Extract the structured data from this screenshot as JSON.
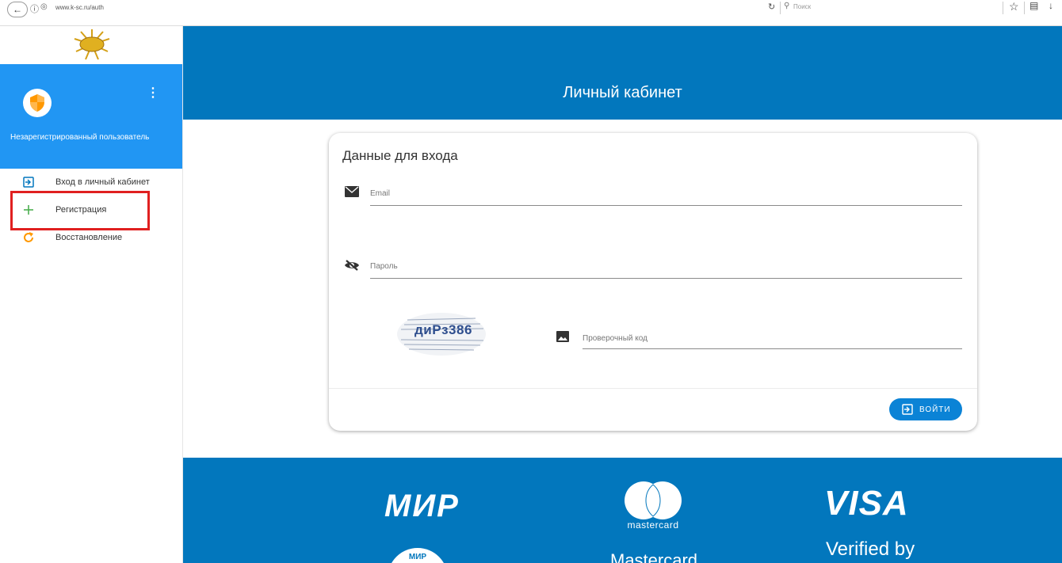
{
  "browser": {
    "url": "www.k-sc.ru/auth",
    "search_placeholder": "Поиск"
  },
  "sidebar": {
    "user_name": "Незарегистрированный пользователь",
    "menu_items": [
      {
        "label": "Вход в личный кабинет",
        "icon": "login-icon",
        "color": "#0277bd"
      },
      {
        "label": "Регистрация",
        "icon": "plus-icon",
        "color": "#4caf50"
      },
      {
        "label": "Восстановление",
        "icon": "refresh-icon",
        "color": "#ff9800"
      }
    ]
  },
  "header": {
    "title": "Личный кабинет"
  },
  "login_card": {
    "title": "Данные для входа",
    "email_label": "Email",
    "password_label": "Пароль",
    "captcha_text": "диРз386",
    "captcha_code_label": "Проверочный код",
    "login_button": "ВОЙТИ"
  },
  "payments": {
    "mir": "МИР",
    "mir_card": "МИР",
    "mastercard_word": "mastercard",
    "mastercard_big": "Mastercard",
    "visa": "VISA",
    "verified": "Verified by"
  },
  "colors": {
    "primary_blue": "#0277bd",
    "user_panel_blue": "#2196f3",
    "highlight_red": "#e02020"
  }
}
